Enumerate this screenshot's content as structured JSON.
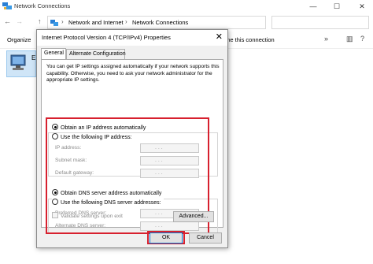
{
  "background_window": {
    "title": "Network Connections",
    "controls": {
      "minimize": "—",
      "maximize": "☐",
      "close": "✕"
    },
    "breadcrumb": [
      "Network and Internet",
      "Network Connections"
    ],
    "organize_label": "Organize",
    "rename_label": "ame this connection",
    "adapter_letter": "E"
  },
  "dialog": {
    "title": "Internet Protocol Version 4 (TCP/IPv4) Properties",
    "close_glyph": "✕",
    "tabs": [
      {
        "label": "General",
        "active": true
      },
      {
        "label": "Alternate Configuration",
        "active": false
      }
    ],
    "intro": "You can get IP settings assigned automatically if your network supports this capability. Otherwise, you need to ask your network administrator for the appropriate IP settings.",
    "ip_section": {
      "auto_label": "Obtain an IP address automatically",
      "auto_selected": true,
      "manual_label": "Use the following IP address:",
      "manual_selected": false,
      "fields": [
        {
          "label": "IP address:",
          "value": ".       .       ."
        },
        {
          "label": "Subnet mask:",
          "value": ".       .       ."
        },
        {
          "label": "Default gateway:",
          "value": ".       .       ."
        }
      ]
    },
    "dns_section": {
      "auto_label": "Obtain DNS server address automatically",
      "auto_selected": true,
      "manual_label": "Use the following DNS server addresses:",
      "manual_selected": false,
      "fields": [
        {
          "label": "Preferred DNS server:",
          "value": ".       .       ."
        },
        {
          "label": "Alternate DNS server:",
          "value": ".       .       ."
        }
      ]
    },
    "validate_label": "Validate settings upon exit",
    "validate_checked": false,
    "advanced_label": "Advanced...",
    "ok_label": "OK",
    "cancel_label": "Cancel"
  },
  "colors": {
    "highlight_box": "#d7202e",
    "ok_border": "#0078d7",
    "dialog_bg": "#f0f0f0",
    "adapter_selection": "#cfe5f7"
  },
  "icons": [
    "network-connections-icon",
    "back-arrow-icon",
    "forward-arrow-icon",
    "up-arrow-icon",
    "network-folder-icon",
    "chevron-right-icon",
    "close-icon",
    "network-adapter-icon"
  ]
}
